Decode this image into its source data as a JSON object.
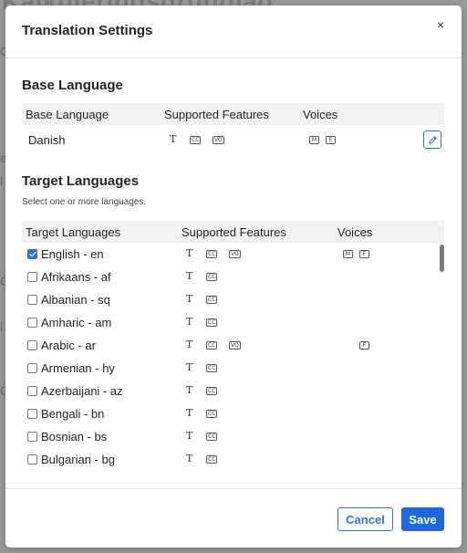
{
  "background": {
    "title_fragment": "Kalkuleringsgrundlag",
    "side_fragments": [
      "C",
      "e",
      "l",
      "C",
      "i",
      "C"
    ]
  },
  "modal": {
    "title": "Translation Settings",
    "close_glyph": "×"
  },
  "base_language": {
    "section_title": "Base Language",
    "headers": {
      "language": "Base Language",
      "features": "Supported Features",
      "voices": "Voices"
    },
    "row": {
      "language": "Danish",
      "features": [
        "T",
        "CC",
        "VO"
      ],
      "voices": [
        "M",
        "F"
      ]
    }
  },
  "target_languages": {
    "section_title": "Target Languages",
    "helper": "Select one or more languages.",
    "headers": {
      "language": "Target Languages",
      "features": "Supported Features",
      "voices": "Voices"
    },
    "rows": [
      {
        "label": "English - en",
        "checked": true,
        "features": [
          "T",
          "CC",
          "VO"
        ],
        "voices": [
          "M",
          "F"
        ]
      },
      {
        "label": "Afrikaans - af",
        "checked": false,
        "features": [
          "T",
          "CC"
        ],
        "voices": []
      },
      {
        "label": "Albanian - sq",
        "checked": false,
        "features": [
          "T",
          "CC"
        ],
        "voices": []
      },
      {
        "label": "Amharic - am",
        "checked": false,
        "features": [
          "T",
          "CC"
        ],
        "voices": []
      },
      {
        "label": "Arabic - ar",
        "checked": false,
        "features": [
          "T",
          "CC",
          "VO"
        ],
        "voices": [
          "F"
        ]
      },
      {
        "label": "Armenian - hy",
        "checked": false,
        "features": [
          "T",
          "CC"
        ],
        "voices": []
      },
      {
        "label": "Azerbaijani - az",
        "checked": false,
        "features": [
          "T",
          "CC"
        ],
        "voices": []
      },
      {
        "label": "Bengali - bn",
        "checked": false,
        "features": [
          "T",
          "CC"
        ],
        "voices": []
      },
      {
        "label": "Bosnian - bs",
        "checked": false,
        "features": [
          "T",
          "CC"
        ],
        "voices": []
      },
      {
        "label": "Bulgarian - bg",
        "checked": false,
        "features": [
          "T",
          "CC"
        ],
        "voices": []
      }
    ]
  },
  "footer": {
    "cancel_label": "Cancel",
    "save_label": "Save"
  },
  "colors": {
    "accent": "#1d6ae0",
    "header_bg": "#f2f2f2"
  }
}
